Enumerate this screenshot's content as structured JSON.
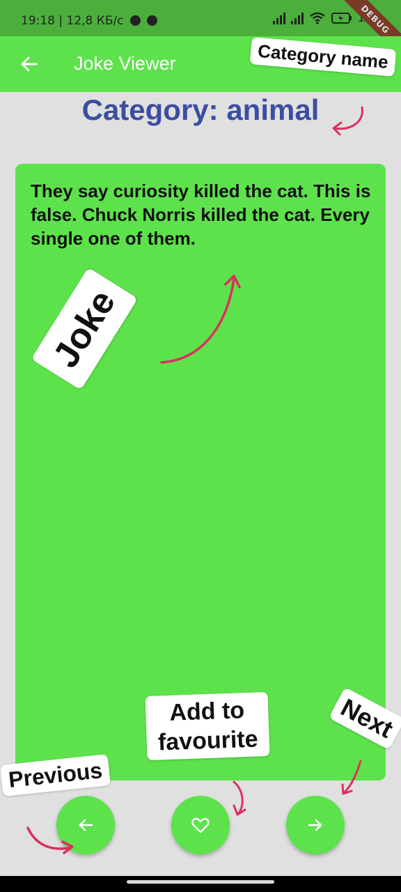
{
  "status_bar": {
    "time_speed": "19:18 | 12,8 КБ/с",
    "battery": "100"
  },
  "debug_banner": "DEBUG",
  "app_bar": {
    "back_icon": "arrow-left-icon",
    "title": "Joke Viewer"
  },
  "category": {
    "label": "Category: animal"
  },
  "joke": {
    "text": "They say curiosity killed the cat. This is false. Chuck Norris killed the cat. Every single one of them."
  },
  "buttons": {
    "previous_icon": "arrow-left-icon",
    "favourite_icon": "heart-outline-icon",
    "next_icon": "arrow-right-icon"
  },
  "annotations": {
    "category_name": "Category name",
    "joke": "Joke",
    "add_to_favourite_line1": "Add to",
    "add_to_favourite_line2": "favourite",
    "next": "Next",
    "previous": "Previous",
    "arrow_color": "#dc2f5e"
  },
  "colors": {
    "app_bar": "#5de24c",
    "status_bar": "#4caf3c",
    "background": "#e0e0e0",
    "category_text": "#3c4ea0",
    "card": "#5de24c"
  }
}
